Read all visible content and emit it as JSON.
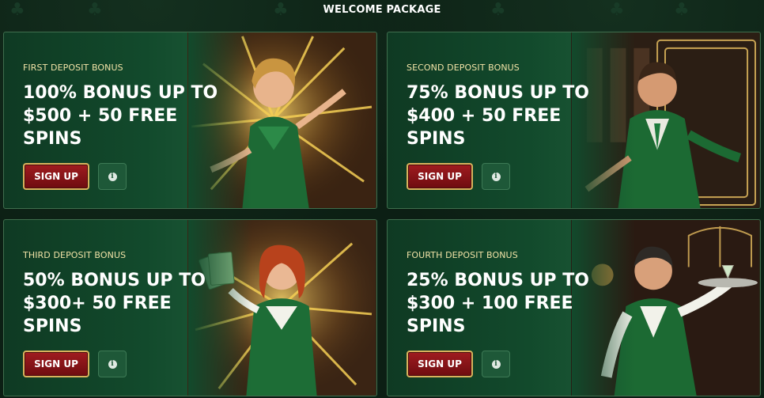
{
  "header": {
    "title": "WELCOME PACKAGE"
  },
  "cards": [
    {
      "label": "FIRST DEPOSIT BONUS",
      "title": "100% BONUS UP TO $500 + 50 FREE SPINS",
      "signup_label": "SIGN UP",
      "info_icon": "info-icon",
      "info_glyph": "i"
    },
    {
      "label": "SECOND DEPOSIT BONUS",
      "title": "75% BONUS UP TO $400 + 50 FREE SPINS",
      "signup_label": "SIGN UP",
      "info_icon": "info-icon",
      "info_glyph": "i"
    },
    {
      "label": "THIRD DEPOSIT BONUS",
      "title": "50% BONUS UP TO $300+ 50 FREE SPINS",
      "signup_label": "SIGN UP",
      "info_icon": "info-icon",
      "info_glyph": "i"
    },
    {
      "label": "FOURTH DEPOSIT BONUS",
      "title": "25% BONUS UP TO $300 + 100 FREE SPINS",
      "signup_label": "SIGN UP",
      "info_icon": "info-icon",
      "info_glyph": "i"
    }
  ],
  "colors": {
    "background": "#0c1f14",
    "card": "#124a2c",
    "accent_gold": "#d8b25c",
    "signup_red": "#a01c20",
    "label_cream": "#f0e2a6"
  }
}
